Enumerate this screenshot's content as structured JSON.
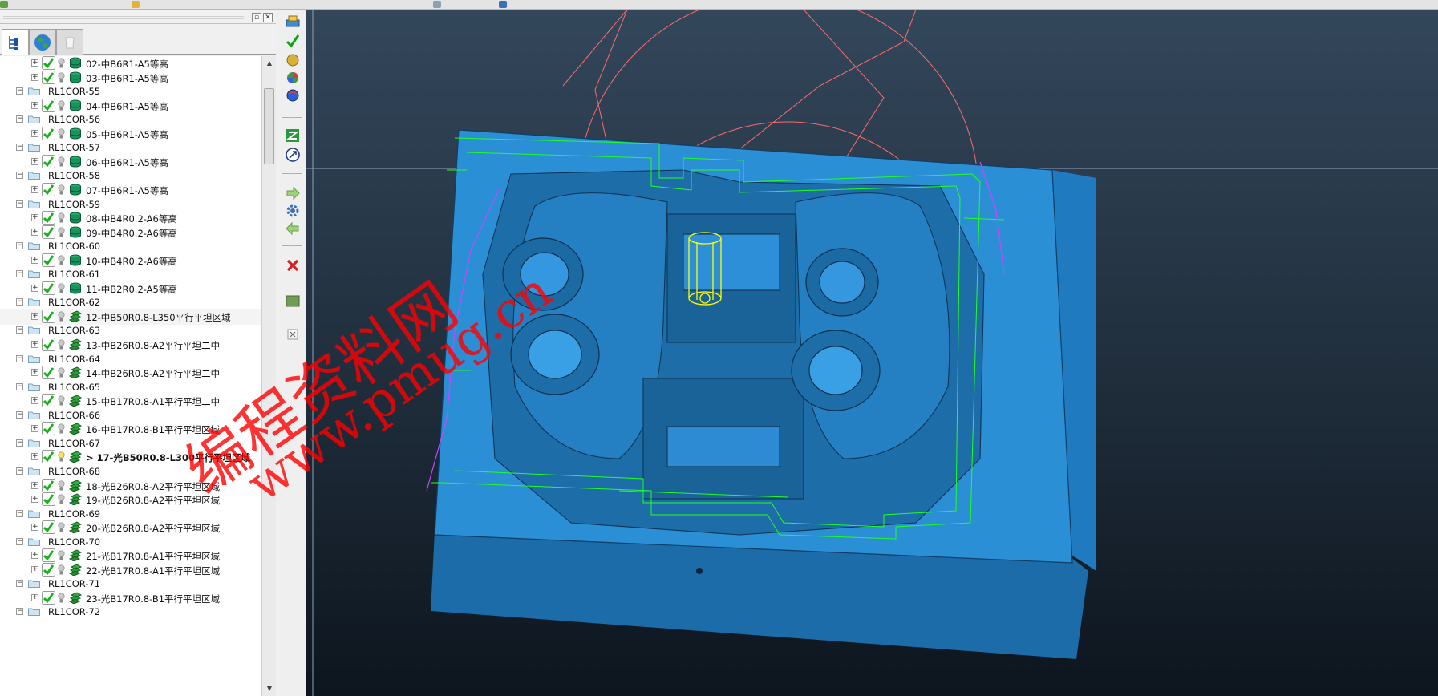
{
  "explorer": {
    "tabs": [
      {
        "name": "tree",
        "active": true
      },
      {
        "name": "globe",
        "active": false
      },
      {
        "name": "empty",
        "active": false
      }
    ],
    "rows": [
      {
        "type": "leaf",
        "label": "02-中B6R1-A5等高",
        "icon": "stack"
      },
      {
        "type": "leaf",
        "label": "03-中B6R1-A5等高",
        "icon": "stack"
      },
      {
        "type": "group",
        "label": "RL1COR-55"
      },
      {
        "type": "leaf",
        "label": "04-中B6R1-A5等高",
        "icon": "stack"
      },
      {
        "type": "group",
        "label": "RL1COR-56"
      },
      {
        "type": "leaf",
        "label": "05-中B6R1-A5等高",
        "icon": "stack"
      },
      {
        "type": "group",
        "label": "RL1COR-57"
      },
      {
        "type": "leaf",
        "label": "06-中B6R1-A5等高",
        "icon": "stack"
      },
      {
        "type": "group",
        "label": "RL1COR-58"
      },
      {
        "type": "leaf",
        "label": "07-中B6R1-A5等高",
        "icon": "stack"
      },
      {
        "type": "group",
        "label": "RL1COR-59"
      },
      {
        "type": "leaf",
        "label": "08-中B4R0.2-A6等高",
        "icon": "stack"
      },
      {
        "type": "leaf",
        "label": "09-中B4R0.2-A6等高",
        "icon": "stack"
      },
      {
        "type": "group",
        "label": "RL1COR-60"
      },
      {
        "type": "leaf",
        "label": "10-中B4R0.2-A6等高",
        "icon": "stack"
      },
      {
        "type": "group",
        "label": "RL1COR-61"
      },
      {
        "type": "leaf",
        "label": "11-中B2R0.2-A5等高",
        "icon": "stack"
      },
      {
        "type": "group",
        "label": "RL1COR-62"
      },
      {
        "type": "leaf",
        "label": "12-中B50R0.8-L350平行平坦区域",
        "icon": "layers",
        "highlight": true
      },
      {
        "type": "group",
        "label": "RL1COR-63"
      },
      {
        "type": "leaf",
        "label": "13-中B26R0.8-A2平行平坦二中",
        "icon": "layers"
      },
      {
        "type": "group",
        "label": "RL1COR-64"
      },
      {
        "type": "leaf",
        "label": "14-中B26R0.8-A2平行平坦二中",
        "icon": "layers"
      },
      {
        "type": "group",
        "label": "RL1COR-65"
      },
      {
        "type": "leaf",
        "label": "15-中B17R0.8-A1平行平坦二中",
        "icon": "layers"
      },
      {
        "type": "group",
        "label": "RL1COR-66"
      },
      {
        "type": "leaf",
        "label": "16-中B17R0.8-B1平行平坦区域",
        "icon": "layers"
      },
      {
        "type": "group",
        "label": "RL1COR-67"
      },
      {
        "type": "leaf",
        "label": "> 17-光B50R0.8-L300平行平坦区域",
        "icon": "layers",
        "current": true
      },
      {
        "type": "group",
        "label": "RL1COR-68"
      },
      {
        "type": "leaf",
        "label": "18-光B26R0.8-A2平行平坦区域",
        "icon": "layers"
      },
      {
        "type": "leaf",
        "label": "19-光B26R0.8-A2平行平坦区域",
        "icon": "layers"
      },
      {
        "type": "group",
        "label": "RL1COR-69"
      },
      {
        "type": "leaf",
        "label": "20-光B26R0.8-A2平行平坦区域",
        "icon": "layers"
      },
      {
        "type": "group",
        "label": "RL1COR-70"
      },
      {
        "type": "leaf",
        "label": "21-光B17R0.8-A1平行平坦区域",
        "icon": "layers"
      },
      {
        "type": "leaf",
        "label": "22-光B17R0.8-A1平行平坦区域",
        "icon": "layers"
      },
      {
        "type": "group",
        "label": "RL1COR-71"
      },
      {
        "type": "leaf",
        "label": "23-光B17R0.8-B1平行平坦区域",
        "icon": "layers"
      },
      {
        "type": "group",
        "label": "RL1COR-72"
      }
    ]
  },
  "toolbar": {
    "buttons": [
      {
        "name": "calculate-toolpath-icon"
      },
      {
        "name": "accept-check-icon"
      },
      {
        "name": "gold-sphere-icon"
      },
      {
        "name": "shaded-sphere-icon"
      },
      {
        "name": "blue-sphere-icon"
      },
      {
        "name": "zoom-fit-icon"
      },
      {
        "name": "resize-icon"
      },
      {
        "name": "forward-arrow-icon"
      },
      {
        "name": "settings-gear-icon"
      },
      {
        "name": "back-arrow-icon"
      },
      {
        "name": "delete-x-icon"
      },
      {
        "name": "green-block-icon"
      },
      {
        "name": "close-small-icon"
      }
    ]
  },
  "watermark": {
    "line1": "编程资料网",
    "line2": "www.pmug.cn",
    "color": "#ff0000"
  },
  "colors": {
    "model_blue": "#2b8fd6",
    "toolpath_green": "#22ff22",
    "boundary_red": "#ff6a6a",
    "tool_yellow": "#ffff00"
  }
}
